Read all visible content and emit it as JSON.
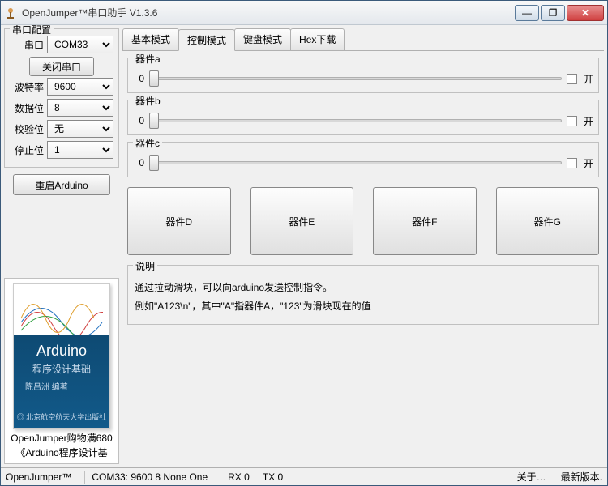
{
  "window": {
    "title": "OpenJumper™串口助手  V1.3.6"
  },
  "winbtns": {
    "min": "—",
    "max": "❐",
    "close": "✕"
  },
  "sidebar": {
    "config_title": "串口配置",
    "port_label": "串口",
    "port_value": "COM33",
    "close_port_btn": "关闭串口",
    "baud_label": "波特率",
    "baud_value": "9600",
    "data_label": "数据位",
    "data_value": "8",
    "parity_label": "校验位",
    "parity_value": "无",
    "stop_label": "停止位",
    "stop_value": "1",
    "restart_btn": "重启Arduino",
    "book_title": "Arduino",
    "book_sub": "程序设计基础",
    "book_author": "陈吕洲  编著",
    "book_pub": "◎ 北京航空航天大学出版社",
    "promo1": "OpenJumper购物满680",
    "promo2": "《Arduino程序设计基"
  },
  "tabs": [
    "基本模式",
    "控制模式",
    "键盘模式",
    "Hex下载"
  ],
  "active_tab": 1,
  "sliders": [
    {
      "title": "器件a",
      "value": "0",
      "cb_label": "开"
    },
    {
      "title": "器件b",
      "value": "0",
      "cb_label": "开"
    },
    {
      "title": "器件c",
      "value": "0",
      "cb_label": "开"
    }
  ],
  "buttons": [
    "器件D",
    "器件E",
    "器件F",
    "器件G"
  ],
  "desc": {
    "title": "说明",
    "line1": "通过拉动滑块，可以向arduino发送控制指令。",
    "line2": "例如\"A123\\n\"，其中\"A\"指器件A，\"123\"为滑块现在的值"
  },
  "status": {
    "brand": "OpenJumper™",
    "conn": "COM33: 9600 8 None One",
    "rx": "RX  0",
    "tx": "TX  0",
    "about": "关于…",
    "latest": "最新版本."
  }
}
